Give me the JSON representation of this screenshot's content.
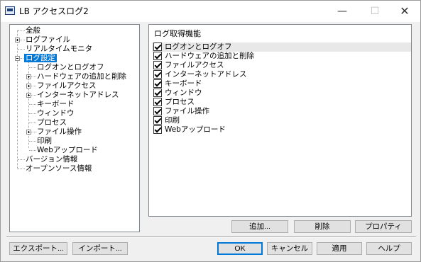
{
  "window": {
    "title": "LB アクセスログ2",
    "minimize_glyph": "—",
    "maximize_glyph": "☐",
    "close_glyph": "✕"
  },
  "tree": {
    "items": [
      {
        "label": "全般"
      },
      {
        "label": "ログファイル"
      },
      {
        "label": "リアルタイムモニタ"
      },
      {
        "label": "ログ設定"
      },
      {
        "label": "ログオンとログオフ"
      },
      {
        "label": "ハードウェアの追加と削除"
      },
      {
        "label": "ファイルアクセス"
      },
      {
        "label": "インターネットアドレス"
      },
      {
        "label": "キーボード"
      },
      {
        "label": "ウィンドウ"
      },
      {
        "label": "プロセス"
      },
      {
        "label": "ファイル操作"
      },
      {
        "label": "印刷"
      },
      {
        "label": "Webアップロード"
      },
      {
        "label": "バージョン情報"
      },
      {
        "label": "オープンソース情報"
      }
    ]
  },
  "features": {
    "header": "ログ取得機能",
    "items": [
      {
        "label": "ログオンとログオフ",
        "checked": true
      },
      {
        "label": "ハードウェアの追加と削除",
        "checked": true
      },
      {
        "label": "ファイルアクセス",
        "checked": true
      },
      {
        "label": "インターネットアドレス",
        "checked": true
      },
      {
        "label": "キーボード",
        "checked": true
      },
      {
        "label": "ウィンドウ",
        "checked": true
      },
      {
        "label": "プロセス",
        "checked": true
      },
      {
        "label": "ファイル操作",
        "checked": true
      },
      {
        "label": "印刷",
        "checked": true
      },
      {
        "label": "Webアップロード",
        "checked": true
      }
    ]
  },
  "buttons": {
    "add": "追加...",
    "delete": "削除",
    "properties": "プロパティ",
    "export": "エクスポート...",
    "import": "インポート...",
    "ok": "OK",
    "cancel": "キャンセル",
    "apply": "適用",
    "help": "ヘルプ"
  },
  "colors": {
    "selection": "#0078d7",
    "default_button_border": "#0078d7"
  }
}
